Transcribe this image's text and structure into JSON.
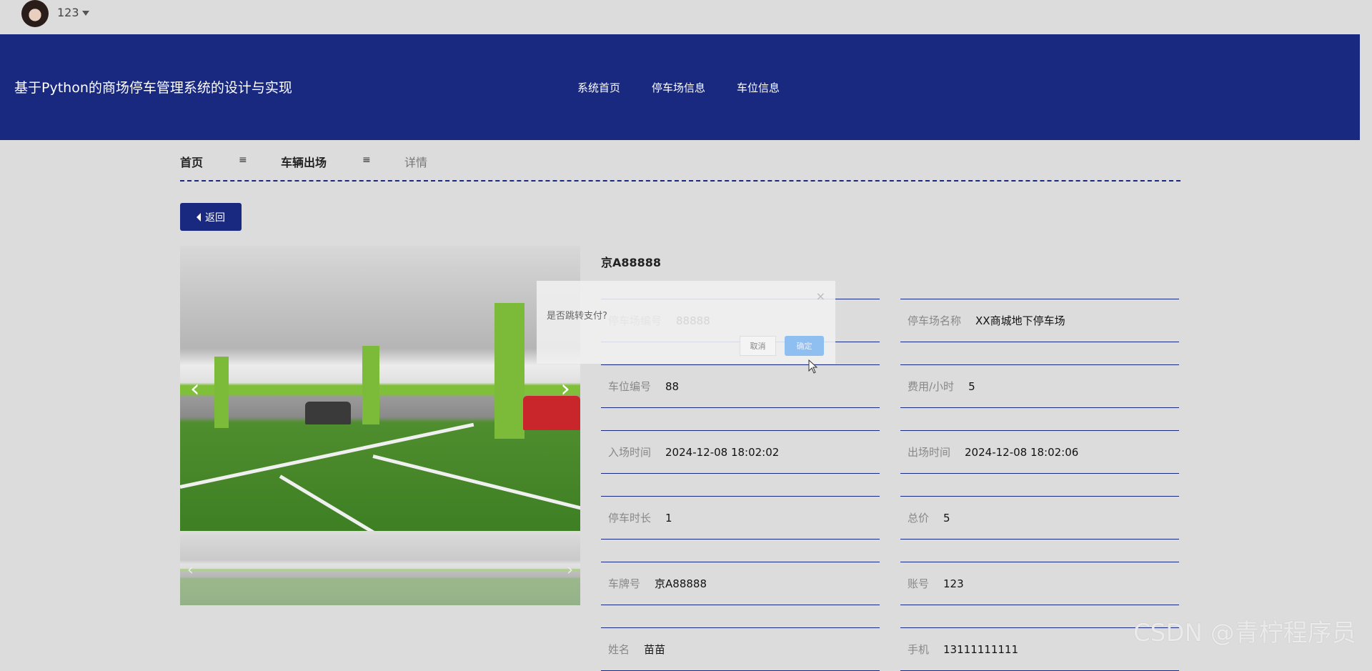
{
  "user": {
    "name": "123"
  },
  "header": {
    "title": "基于Python的商场停车管理系统的设计与实现",
    "nav": [
      "系统首页",
      "停车场信息",
      "车位信息"
    ]
  },
  "breadcrumb": {
    "home": "首页",
    "sep": "≡",
    "section": "车辆出场",
    "current": "详情"
  },
  "back_label": "返回",
  "detail": {
    "plate_title": "京A88888",
    "fields": [
      {
        "label": "停车场编号",
        "value": "88888"
      },
      {
        "label": "停车场名称",
        "value": "XX商城地下停车场"
      },
      {
        "label": "车位编号",
        "value": "88"
      },
      {
        "label": "费用/小时",
        "value": "5"
      },
      {
        "label": "入场时间",
        "value": "2024-12-08 18:02:02"
      },
      {
        "label": "出场时间",
        "value": "2024-12-08 18:02:06"
      },
      {
        "label": "停车时长",
        "value": "1"
      },
      {
        "label": "总价",
        "value": "5"
      },
      {
        "label": "车牌号",
        "value": "京A88888"
      },
      {
        "label": "账号",
        "value": "123"
      },
      {
        "label": "姓名",
        "value": "苗苗"
      },
      {
        "label": "手机",
        "value": "13111111111"
      }
    ]
  },
  "carousel": {
    "prev": "‹",
    "next": "›"
  },
  "dialog": {
    "message": "是否跳转支付?",
    "close": "×",
    "cancel": "取消",
    "confirm": "确定"
  },
  "colors": {
    "primary": "#1a2980",
    "background": "#dcdcdc",
    "confirm": "#8fbef0"
  },
  "watermark": "CSDN @青柠程序员"
}
